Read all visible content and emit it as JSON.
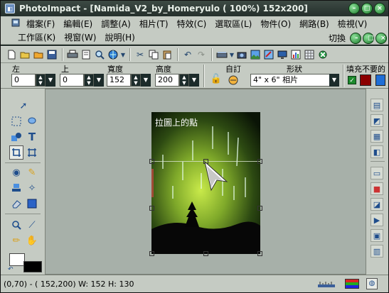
{
  "titlebar": {
    "title": "PhotoImpact - [Namida_V2_by_Homeryulo ( 100%) 152x200]",
    "app_icon": "photoimpact-app-icon",
    "buttons": [
      "minimize-icon",
      "maximize-icon",
      "close-icon"
    ]
  },
  "menubar": {
    "items": [
      "檔案(F)",
      "編輯(E)",
      "調整(A)",
      "相片(T)",
      "特效(C)",
      "選取區(L)",
      "物件(O)",
      "網路(B)",
      "檢視(V)"
    ],
    "items_row2": [
      "工作區(K)",
      "視窗(W)",
      "說明(H)"
    ],
    "switch_label": "切換"
  },
  "toolbar": {
    "icons": [
      "new-file-icon",
      "open-folder-icon",
      "browse-folder-icon",
      "save-icon",
      "print-icon",
      "print-preview-icon",
      "zoom-icon",
      "web-icon",
      "cut-icon",
      "copy-icon",
      "paste-icon",
      "undo-icon",
      "redo-icon",
      "scanner-icon",
      "camera-icon",
      "image-icon",
      "image-edit-icon",
      "monitor-icon",
      "chart-icon",
      "grid-icon",
      "gear-icon"
    ]
  },
  "attributes": {
    "left_label": "左",
    "left_value": "0",
    "top_label": "上",
    "top_value": "0",
    "width_label": "寬度",
    "width_value": "152",
    "height_label": "高度",
    "height_value": "200",
    "custom_label": "自訂",
    "shape_label": "形狀",
    "shape_value": "4\" x 6\" 相片",
    "fill_label": "填充不要的"
  },
  "canvas": {
    "hint_text": "拉圖上的點"
  },
  "statusbar": {
    "coords": "(0,70) - ( 152,200) W: 152 H: 130"
  },
  "colors": {
    "foreground": "#000000",
    "background": "#ffffff",
    "fill_swatch": "#8b0000",
    "accent_green": "#1d8a2d"
  }
}
